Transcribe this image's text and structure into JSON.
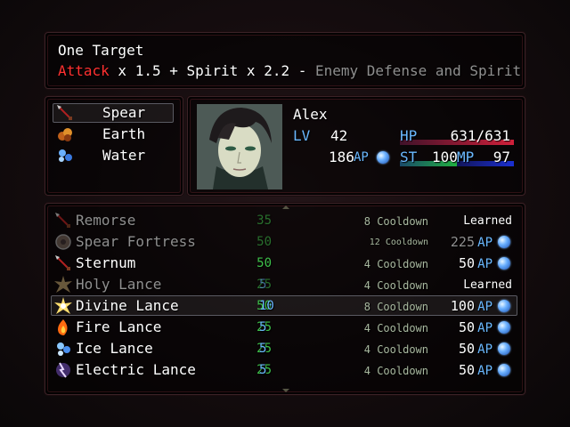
{
  "help": {
    "line1": "One Target",
    "formula_attack": "Attack",
    "formula_mid": " x 1.5 + Spirit x 2.2 - ",
    "formula_defense": "Enemy Defense and Spirit"
  },
  "skill_types": {
    "items": [
      {
        "label": "Spear",
        "icon": "spear-icon",
        "selected": true
      },
      {
        "label": "Earth",
        "icon": "earth-icon",
        "selected": false
      },
      {
        "label": "Water",
        "icon": "water-icon",
        "selected": false
      }
    ]
  },
  "actor": {
    "name": "Alex",
    "level_label": "LV",
    "level": "42",
    "ap_value": "186",
    "ap_label": "AP",
    "hp_label": "HP",
    "hp": "631/631",
    "hp_fraction": 1.0,
    "st_label": "ST",
    "st": "100",
    "st_fraction": 1.0,
    "mp_label": "MP",
    "mp": "97",
    "mp_fraction": 1.0
  },
  "skills": [
    {
      "name": "Remorse",
      "icon": "spear-icon",
      "cost1": "35",
      "cost2": "",
      "cooldown": "8 Cooldown",
      "status": "Learned",
      "status_ap": "",
      "dim": true,
      "small": false,
      "selected": false
    },
    {
      "name": "Spear Fortress",
      "icon": "shield-icon",
      "cost1": "50",
      "cost2": "",
      "cooldown": "12 Cooldown",
      "status": "225",
      "status_ap": "AP",
      "dim": true,
      "small": true,
      "selected": false
    },
    {
      "name": "Sternum",
      "icon": "spear-icon",
      "cost1": "50",
      "cost2": "",
      "cooldown": "4 Cooldown",
      "status": "50",
      "status_ap": "AP",
      "dim": false,
      "small": false,
      "selected": false
    },
    {
      "name": "Holy Lance",
      "icon": "holy-burst-icon",
      "cost1": "25",
      "cost2": "5",
      "cooldown": "4 Cooldown",
      "status": "Learned",
      "status_ap": "",
      "dim": true,
      "small": false,
      "selected": false
    },
    {
      "name": "Divine Lance",
      "icon": "divine-burst-icon",
      "cost1": "50",
      "cost2": "10",
      "cooldown": "8 Cooldown",
      "status": "100",
      "status_ap": "AP",
      "dim": false,
      "small": false,
      "selected": true
    },
    {
      "name": "Fire Lance",
      "icon": "fire-icon",
      "cost1": "25",
      "cost2": "5",
      "cooldown": "4 Cooldown",
      "status": "50",
      "status_ap": "AP",
      "dim": false,
      "small": false,
      "selected": false
    },
    {
      "name": "Ice Lance",
      "icon": "ice-icon",
      "cost1": "25",
      "cost2": "5",
      "cooldown": "4 Cooldown",
      "status": "50",
      "status_ap": "AP",
      "dim": false,
      "small": false,
      "selected": false
    },
    {
      "name": "Electric Lance",
      "icon": "electric-icon",
      "cost1": "25",
      "cost2": "5",
      "cooldown": "4 Cooldown",
      "status": "50",
      "status_ap": "AP",
      "dim": false,
      "small": false,
      "selected": false
    }
  ],
  "colors": {
    "attack": "#ff3030",
    "accent_blue": "#6ab8ff",
    "cost_green": "#3ec04a",
    "hp_bar": "#d0203a",
    "st_bar": "#20a040",
    "mp_bar": "#1a2fd0"
  }
}
